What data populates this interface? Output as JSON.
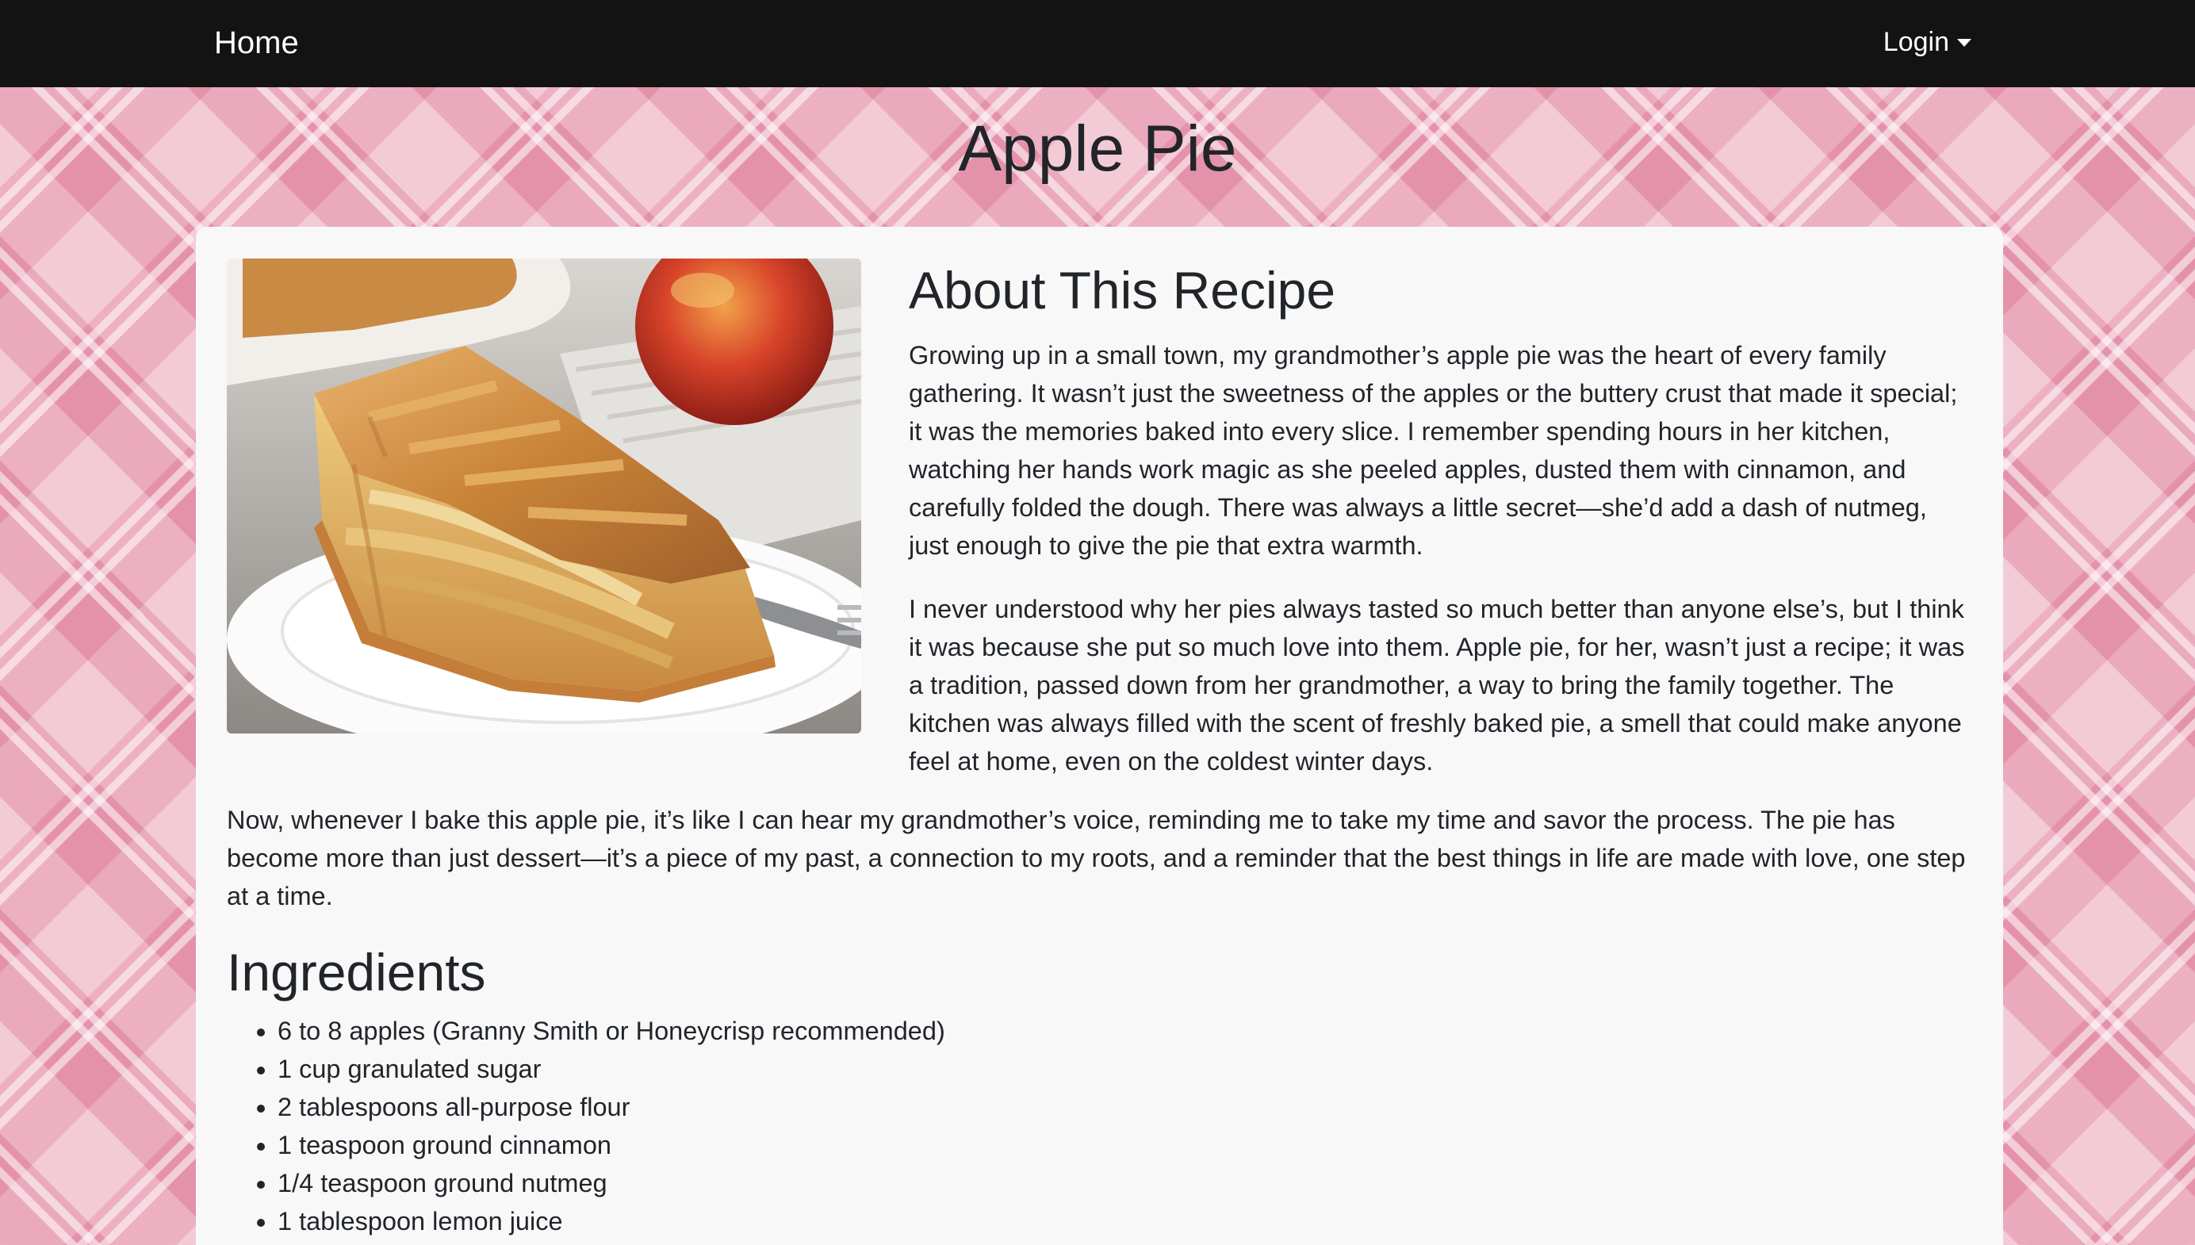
{
  "nav": {
    "home_label": "Home",
    "login_label": "Login"
  },
  "page": {
    "title": "Apple Pie"
  },
  "about": {
    "heading": "About This Recipe",
    "image_alt": "slice of apple pie on a plate",
    "paragraph_1": "Growing up in a small town, my grandmother’s apple pie was the heart of every family gathering. It wasn’t just the sweetness of the apples or the buttery crust that made it special; it was the memories baked into every slice. I remember spending hours in her kitchen, watching her hands work magic as she peeled apples, dusted them with cinnamon, and carefully folded the dough. There was always a little secret—she’d add a dash of nutmeg, just enough to give the pie that extra warmth.",
    "paragraph_2": "I never understood why her pies always tasted so much better than anyone else’s, but I think it was because she put so much love into them. Apple pie, for her, wasn’t just a recipe; it was a tradition, passed down from her grandmother, a way to bring the family together. The kitchen was always filled with the scent of freshly baked pie, a smell that could make anyone feel at home, even on the coldest winter days.",
    "paragraph_3": "Now, whenever I bake this apple pie, it’s like I can hear my grandmother’s voice, reminding me to take my time and savor the process. The pie has become more than just dessert—it’s a piece of my past, a connection to my roots, and a reminder that the best things in life are made with love, one step at a time."
  },
  "ingredients": {
    "heading": "Ingredients",
    "items": [
      "6 to 8 apples (Granny Smith or Honeycrisp recommended)",
      "1 cup granulated sugar",
      "2 tablespoons all-purpose flour",
      "1 teaspoon ground cinnamon",
      "1/4 teaspoon ground nutmeg",
      "1 tablespoon lemon juice"
    ]
  },
  "colors": {
    "navbar": "#131313",
    "card": "#f8f8f9",
    "background_pink": "#eeb3c4",
    "text": "#212529"
  }
}
